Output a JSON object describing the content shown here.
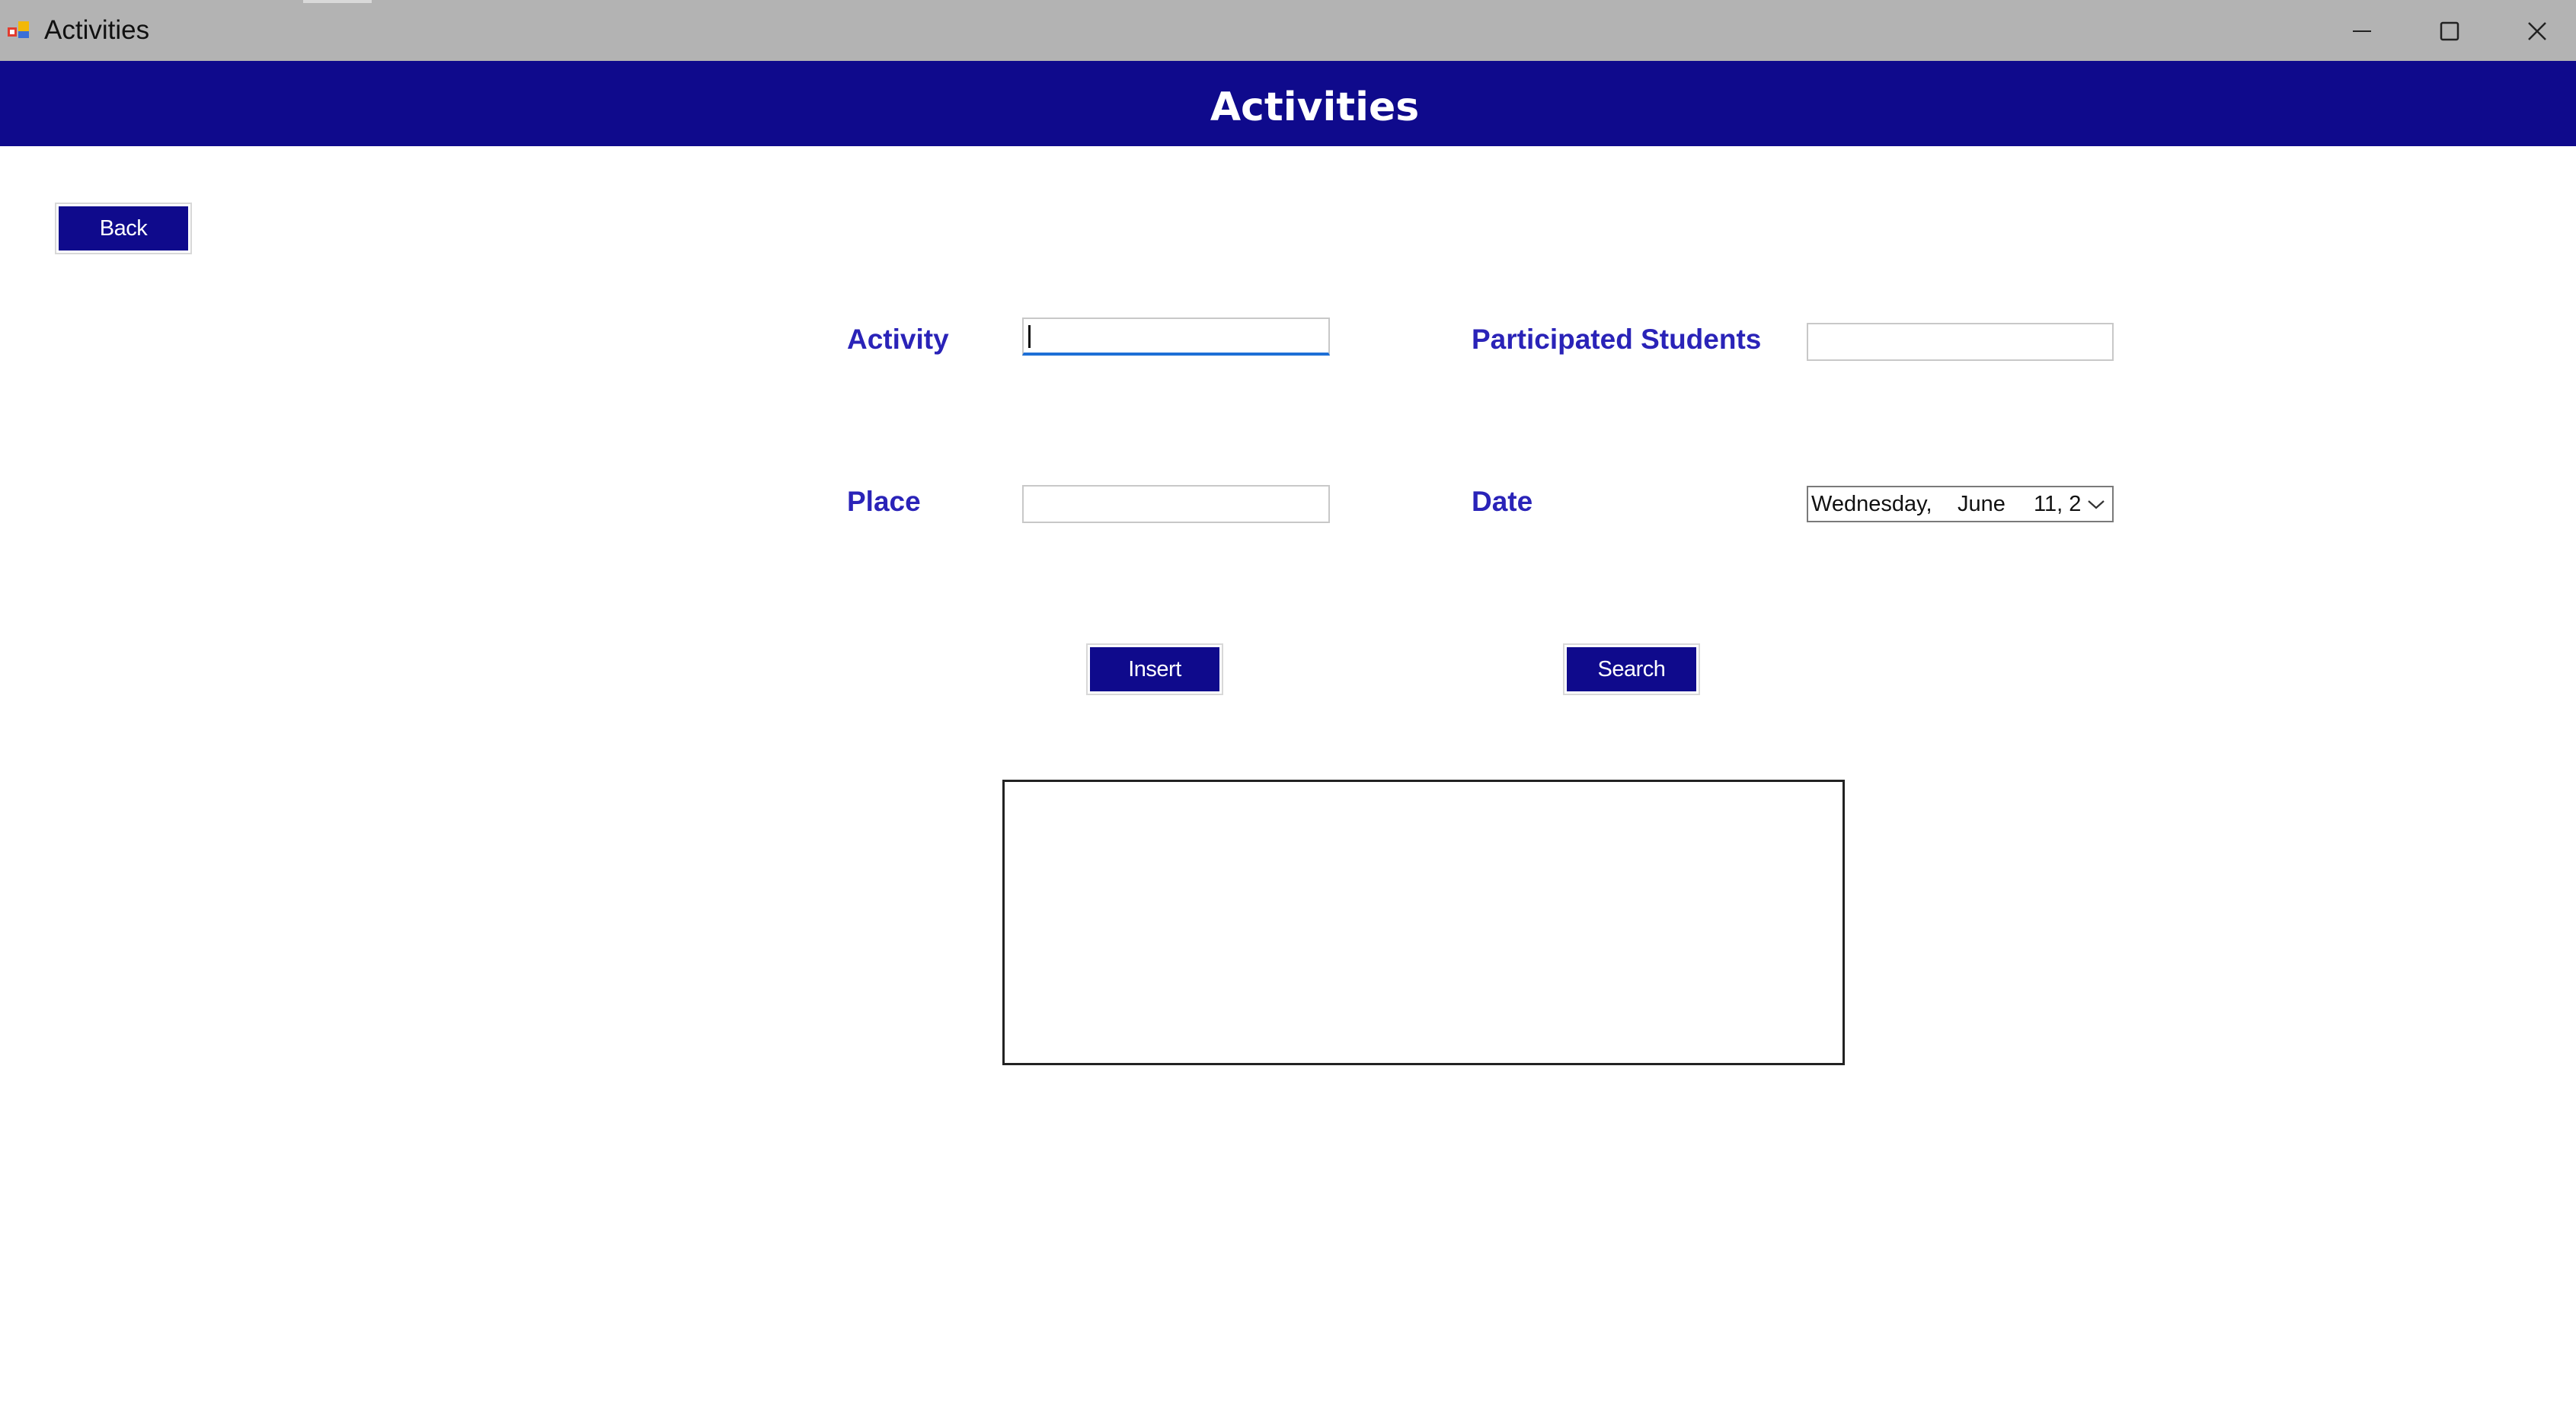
{
  "window": {
    "title": "Activities",
    "icon": "winforms-app-icon",
    "controls": {
      "minimize_icon": "minimize-icon",
      "maximize_icon": "maximize-icon",
      "close_icon": "close-icon"
    }
  },
  "header": {
    "title": "Activities",
    "background": "#0f0a8c"
  },
  "nav": {
    "back_label": "Back"
  },
  "form": {
    "activity_label": "Activity",
    "activity_value": "",
    "participated_label": "Participated Students",
    "participated_value": "",
    "place_label": "Place",
    "place_value": "",
    "date_label": "Date",
    "date": {
      "weekday": "Wednesday,",
      "month": "June",
      "day_year": "11, 2"
    }
  },
  "actions": {
    "insert_label": "Insert",
    "search_label": "Search"
  },
  "colors": {
    "accent": "#0f0a8c",
    "label": "#2a23b8",
    "titlebar": "#b3b3b3",
    "focus": "#1e6fd6"
  }
}
